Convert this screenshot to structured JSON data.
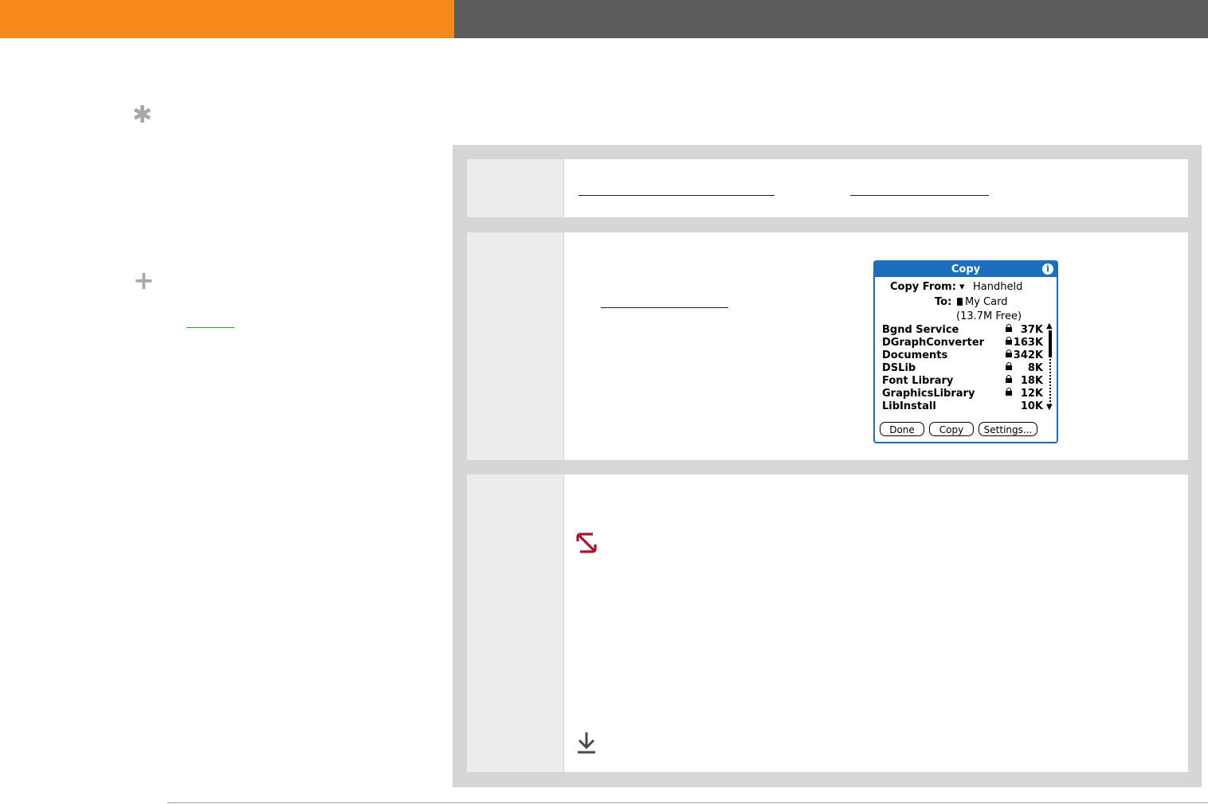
{
  "dialog": {
    "title": "Copy",
    "info_icon": "info-icon",
    "copy_from_label": "Copy From:",
    "copy_from_arrow": "▾",
    "copy_from_value": "Handheld",
    "to_label": "To:",
    "to_value": "My Card",
    "free_space": "(13.7M Free)",
    "apps": [
      {
        "name": "Bgnd Service",
        "locked": true,
        "size": "37K"
      },
      {
        "name": "DGraphConverter",
        "locked": true,
        "size": "163K"
      },
      {
        "name": "Documents",
        "locked": true,
        "size": "342K"
      },
      {
        "name": "DSLib",
        "locked": true,
        "size": "8K"
      },
      {
        "name": "Font Library",
        "locked": true,
        "size": "18K"
      },
      {
        "name": "GraphicsLibrary",
        "locked": true,
        "size": "12K"
      },
      {
        "name": "LibInstall",
        "locked": false,
        "size": "10K"
      }
    ],
    "buttons": {
      "done": "Done",
      "copy": "Copy",
      "settings": "Settings..."
    }
  },
  "sidebar": {
    "tip_icon": "asterisk-icon",
    "plus_icon": "plus-icon"
  },
  "colors": {
    "header_orange": "#f7891b",
    "header_gray": "#5b5b5b",
    "dialog_blue": "#1b6fbd",
    "warning_red": "#b0102a",
    "link_green": "#2fa12f"
  },
  "icons": {
    "warning": "no-entry-icon",
    "continue": "down-arrow-icon"
  }
}
